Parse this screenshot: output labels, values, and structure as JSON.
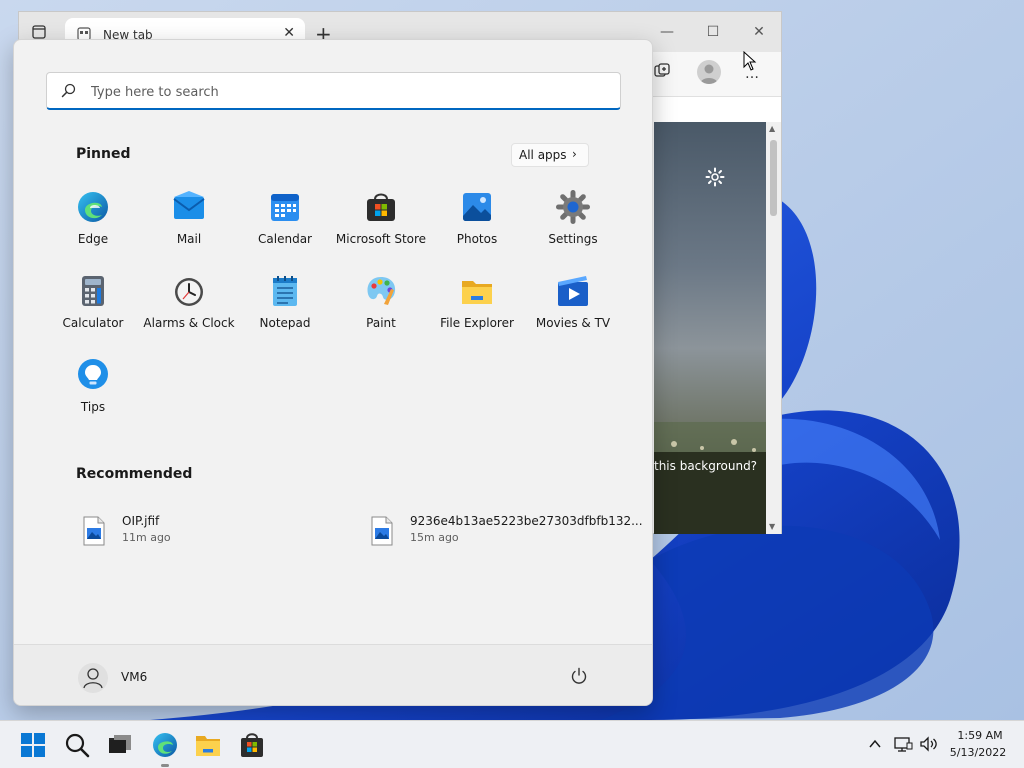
{
  "browser": {
    "tab_title": "New tab",
    "background_caption": "this background?"
  },
  "start_menu": {
    "search": {
      "placeholder": "Type here to search"
    },
    "pinned_title": "Pinned",
    "all_apps_label": "All apps",
    "pinned_apps": [
      {
        "label": "Edge",
        "icon": "edge-icon"
      },
      {
        "label": "Mail",
        "icon": "mail-icon"
      },
      {
        "label": "Calendar",
        "icon": "calendar-icon"
      },
      {
        "label": "Microsoft Store",
        "icon": "store-icon"
      },
      {
        "label": "Photos",
        "icon": "photos-icon"
      },
      {
        "label": "Settings",
        "icon": "settings-gear-icon"
      },
      {
        "label": "Calculator",
        "icon": "calculator-icon"
      },
      {
        "label": "Alarms & Clock",
        "icon": "clock-icon"
      },
      {
        "label": "Notepad",
        "icon": "notepad-icon"
      },
      {
        "label": "Paint",
        "icon": "paint-palette-icon"
      },
      {
        "label": "File Explorer",
        "icon": "folder-icon"
      },
      {
        "label": "Movies & TV",
        "icon": "movies-play-icon"
      },
      {
        "label": "Tips",
        "icon": "lightbulb-icon"
      }
    ],
    "recommended_title": "Recommended",
    "recommended": [
      {
        "name": "OIP.jfif",
        "time": "11m ago",
        "icon": "image-file-icon"
      },
      {
        "name": "9236e4b13ae5223be27303dfbfb132...",
        "time": "15m ago",
        "icon": "image-file-icon"
      }
    ],
    "user_name": "VM6"
  },
  "taskbar": {
    "time": "1:59 AM",
    "date": "5/13/2022",
    "icons": [
      "windows-start-icon",
      "search-icon",
      "task-view-icon",
      "edge-icon",
      "file-explorer-icon",
      "store-icon"
    ]
  },
  "colors": {
    "accent": "#0067c0",
    "wallpaper_blue": "#1f4fd6",
    "start_bg": "#f2f2f2"
  }
}
